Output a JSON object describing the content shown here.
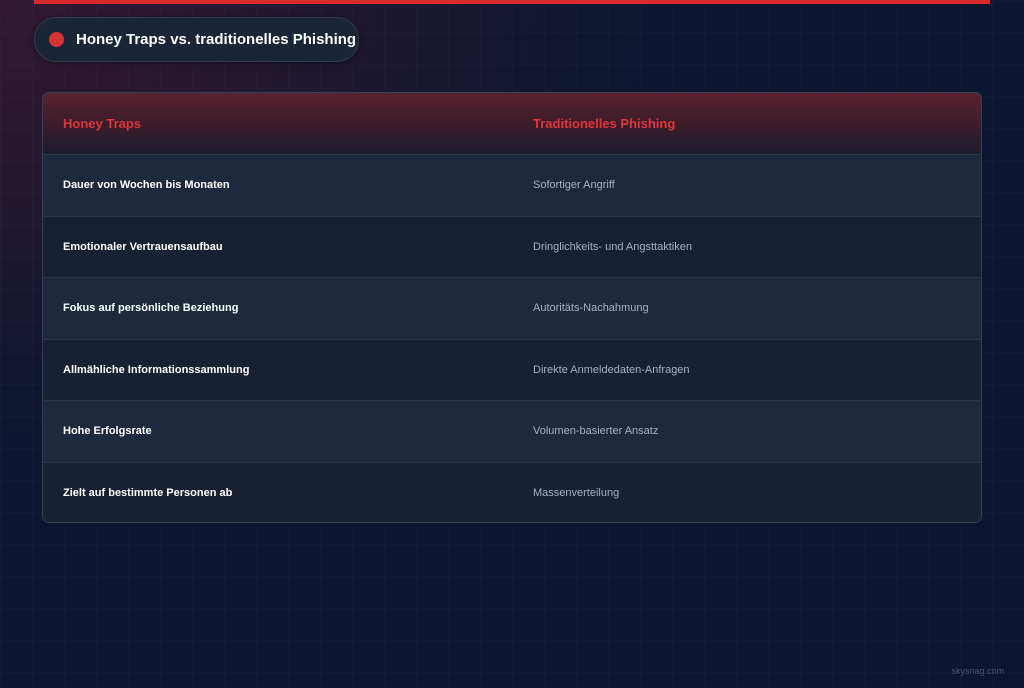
{
  "header": {
    "title": "Honey Traps vs. traditionelles Phishing"
  },
  "table": {
    "columns": [
      "Honey Traps",
      "Traditionelles Phishing"
    ],
    "rows": [
      [
        "Dauer von Wochen bis Monaten",
        "Sofortiger Angriff"
      ],
      [
        "Emotionaler Vertrauensaufbau",
        "Dringlichkeits- und Angsttaktiken"
      ],
      [
        "Fokus auf persönliche Beziehung",
        "Autoritäts-Nachahmung"
      ],
      [
        "Allmähliche Informationssammlung",
        "Direkte Anmeldedaten-Anfragen"
      ],
      [
        "Hohe Erfolgsrate",
        "Volumen-basierter Ansatz"
      ],
      [
        "Zielt auf bestimmte Personen ab",
        "Massenverteilung"
      ]
    ]
  },
  "footer": {
    "watermark": "skysnag.com"
  },
  "colors": {
    "accent": "#d92b2b",
    "header_text": "#e0353a",
    "background": "#0d1630"
  }
}
